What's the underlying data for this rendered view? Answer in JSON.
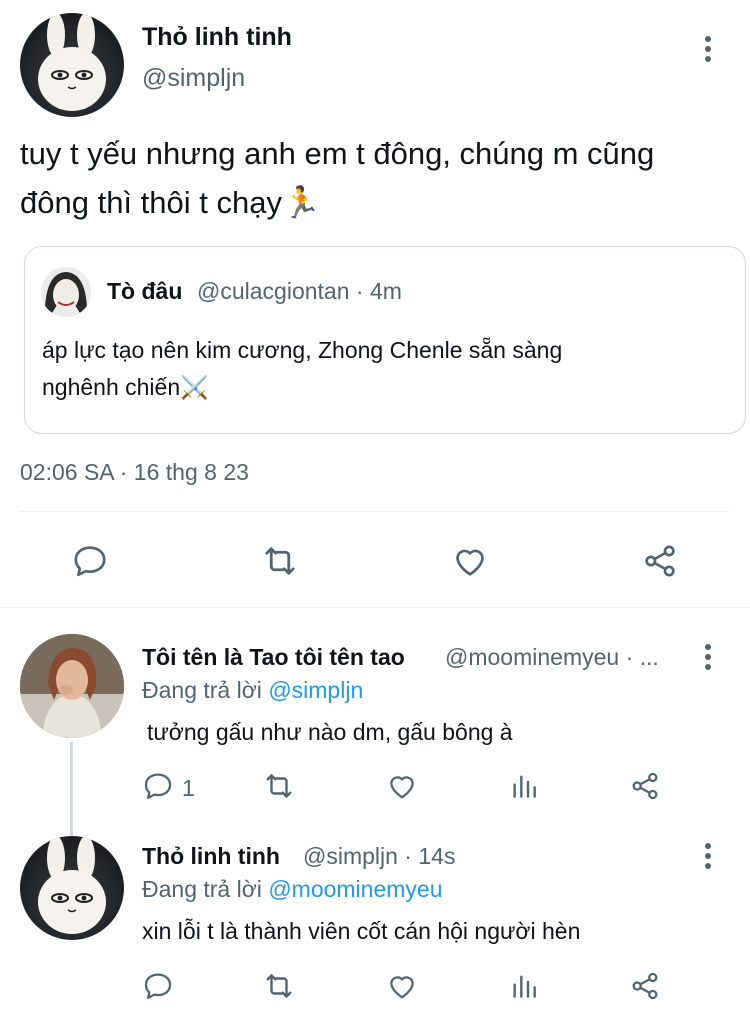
{
  "main_tweet": {
    "author_name": "Thỏ linh tinh",
    "handle": "@simpljn",
    "text_line1": "tuy t yếu nhưng anh em t đông, chúng m cũng",
    "text_line2": "đông thì thôi t chạy🏃",
    "quote": {
      "author_name": "Tò đâu",
      "meta": "@culacgiontan · 4m",
      "text_line1": "áp lực tạo nên kim cương, Zhong Chenle sẵn sàng",
      "text_line2": "nghênh chiến⚔️"
    },
    "timestamp": "02:06 SA · 16 thg 8 23"
  },
  "replies": [
    {
      "author_name": "Tôi tên là Tao tôi tên tao",
      "meta": "@moominemyeu · ...",
      "replying_prefix": "Đang trả lời ",
      "replying_to": "@simpljn",
      "text": "tưởng gấu như nào dm, gấu bông à",
      "reply_count": "1"
    },
    {
      "author_name": "Thỏ linh tinh",
      "meta": "@simpljn · 14s",
      "replying_prefix": "Đang trả lời ",
      "replying_to": "@moominemyeu",
      "text": "xin lỗi t là thành viên cốt cán hội người hèn",
      "reply_count": ""
    }
  ],
  "icons": {
    "reply": "reply-icon",
    "retweet": "retweet-icon",
    "like": "heart-icon",
    "share": "share-icon",
    "views": "views-icon",
    "more": "more-vertical-icon"
  },
  "colors": {
    "text": "#0f1419",
    "muted": "#536471",
    "link": "#1d9bf0",
    "border": "#cfd9de"
  }
}
